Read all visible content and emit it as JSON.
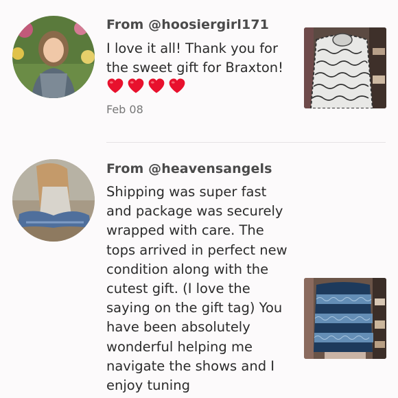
{
  "reviews": [
    {
      "author": "From @hoosiergirl171",
      "text": "I love it all! Thank you for the sweet gift for Braxton!",
      "hearts": 4,
      "date": "Feb 08",
      "avatar_icon": "avatar-photo-woman-garden",
      "thumb_icon": "product-photo-printed-top"
    },
    {
      "author": "From @heavensangels",
      "text": "Shipping was super fast and package was securely wrapped with care. The tops arrived in perfect new condition along with the cutest gift. (I love the saying on the gift tag) You have been absolutely wonderful helping me navigate the shows and I enjoy tuning",
      "avatar_icon": "avatar-photo-woman-sitting",
      "thumb_icon": "product-photo-blue-lace-top"
    }
  ],
  "colors": {
    "heart": "#e8112d",
    "divider": "#e6e2e4",
    "background": "#fcfafb"
  }
}
